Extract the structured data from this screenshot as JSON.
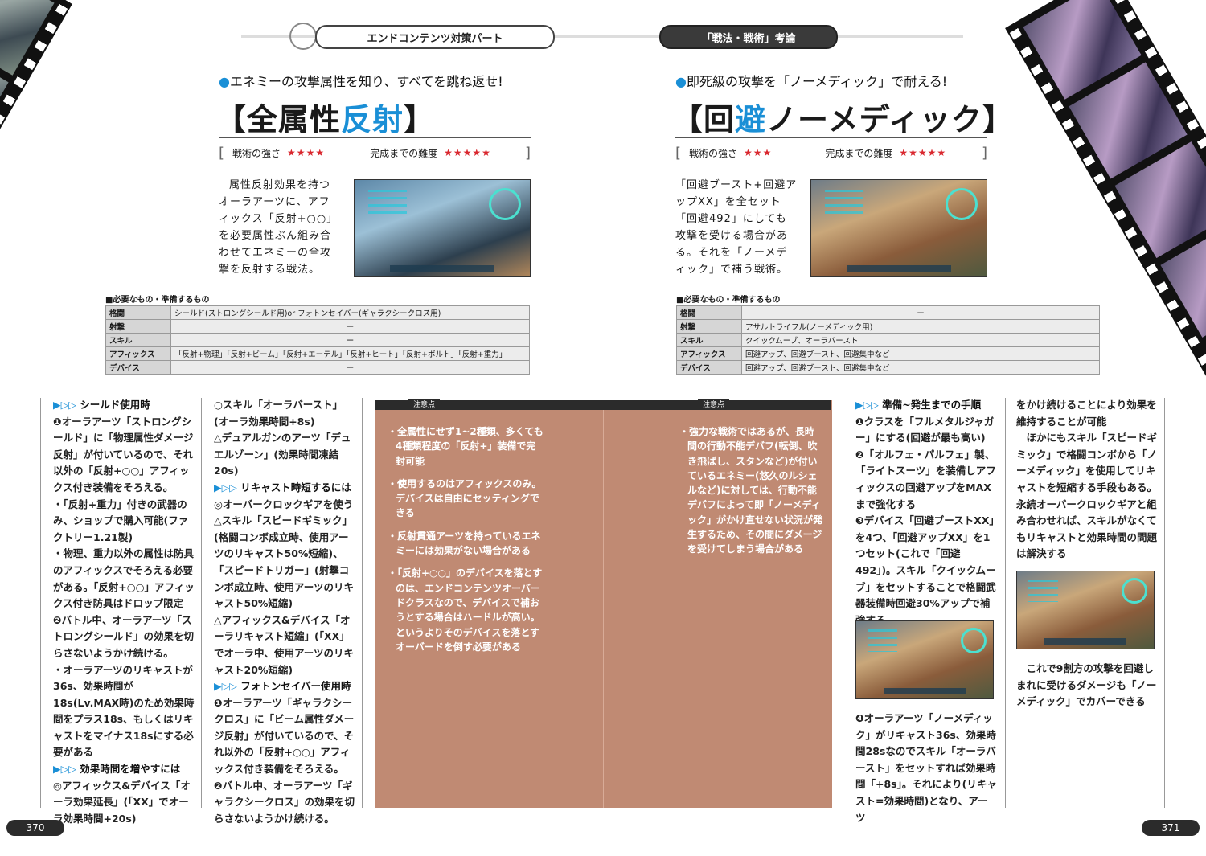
{
  "header": {
    "left_tab": "エンドコンテンツ対策パート",
    "right_tab": "「戦法・戦術」考論"
  },
  "left": {
    "kicker": "エネミーの攻撃属性を知り、すべてを跳ね返せ!",
    "title_pre": "【全属性",
    "title_hl": "反射",
    "title_post": "】",
    "strength_label": "戦術の強さ",
    "strength_stars": "★★★★",
    "difficulty_label": "完成までの難度",
    "difficulty_stars": "★★★★★",
    "intro": "属性反射効果を持つオーラアーツに、アフィックス「反射+○○」を必要属性ぶん組み合わせてエネミーの全攻撃を反射する戦法。",
    "req_label": "■必要なもの・準備するもの",
    "req": [
      {
        "k": "格闘",
        "v": "シールド(ストロングシールド用)or フォトンセイバー(ギャラクシークロス用)",
        "center": false
      },
      {
        "k": "射撃",
        "v": "ー",
        "center": true
      },
      {
        "k": "スキル",
        "v": "ー",
        "center": true
      },
      {
        "k": "アフィックス",
        "v": "「反射+物理」「反射+ビーム」「反射+エーテル」「反射+ヒート」「反射+ボルト」「反射+重力」",
        "center": false
      },
      {
        "k": "デバイス",
        "v": "ー",
        "center": true
      }
    ]
  },
  "right": {
    "kicker": "即死級の攻撃を「ノーメディック」で耐える!",
    "title_pre": "【回",
    "title_hl": "避",
    "title_post": "ノーメディック】",
    "strength_label": "戦術の強さ",
    "strength_stars": "★★★",
    "difficulty_label": "完成までの難度",
    "difficulty_stars": "★★★★★",
    "intro": "「回避ブースト+回避アップXX」を全セット「回避492」にしても攻撃を受ける場合がある。それを「ノーメディック」で補う戦術。",
    "req_label": "■必要なもの・準備するもの",
    "req": [
      {
        "k": "格闘",
        "v": "ー",
        "center": true
      },
      {
        "k": "射撃",
        "v": "アサルトライフル(ノーメディック用)",
        "center": false
      },
      {
        "k": "スキル",
        "v": "クイックムーブ、オーラバースト",
        "center": false
      },
      {
        "k": "アフィックス",
        "v": "回避アップ、回避ブースト、回避集中など",
        "center": false
      },
      {
        "k": "デバイス",
        "v": "回避アップ、回避ブースト、回避集中など",
        "center": false
      }
    ]
  },
  "col1": [
    {
      "t": "h",
      "v": "シールド使用時"
    },
    {
      "t": "p",
      "v": "❶オーラアーツ「ストロングシールド」に「物理属性ダメージ反射」が付いているので、それ以外の「反射+○○」アフィックス付き装備をそろえる。"
    },
    {
      "t": "p",
      "v": "・「反射+重力」付きの武器のみ、ショップで購入可能(ファクトリー1.21製)"
    },
    {
      "t": "p",
      "v": "・物理、重力以外の属性は防具のアフィックスでそろえる必要がある。「反射+○○」アフィックス付き防具はドロップ限定"
    },
    {
      "t": "p",
      "v": "❷バトル中、オーラアーツ「ストロングシールド」の効果を切らさないようかけ続ける。"
    },
    {
      "t": "p",
      "v": "・オーラアーツのリキャストが36s、効果時間が18s(Lv.MAX時)のため効果時間をプラス18s、もしくはリキャストをマイナス18sにする必要がある"
    },
    {
      "t": "h",
      "v": "効果時間を増やすには"
    },
    {
      "t": "p",
      "v": "◎アフィックス&デバイス「オーラ効果延長」(「XX」でオーラ効果時間+20s)"
    }
  ],
  "col2": [
    {
      "t": "p",
      "v": "○スキル「オーラバースト」(オーラ効果時間+8s)"
    },
    {
      "t": "p",
      "v": "△デュアルガンのアーツ「デュエルゾーン」(効果時間凍結20s)"
    },
    {
      "t": "h",
      "v": "リキャスト時短するには"
    },
    {
      "t": "p",
      "v": "◎オーバークロックギアを使う"
    },
    {
      "t": "p",
      "v": "△スキル「スピードギミック」(格闘コンボ成立時、使用アーツのリキャスト50%短縮)、「スピードトリガー」(射撃コンボ成立時、使用アーツのリキャスト50%短縮)"
    },
    {
      "t": "p",
      "v": "△アフィックス&デバイス「オーラリキャスト短縮」(「XX」でオーラ中、使用アーツのリキャスト20%短縮)"
    },
    {
      "t": "h",
      "v": "フォトンセイバー使用時"
    },
    {
      "t": "p",
      "v": "❶オーラアーツ「ギャラクシークロス」に「ビーム属性ダメージ反射」が付いているので、それ以外の「反射+○○」アフィックス付き装備をそろえる。"
    },
    {
      "t": "p",
      "v": "❷バトル中、オーラアーツ「ギャラクシークロス」の効果を切らさないようかけ続ける。"
    }
  ],
  "note_left": {
    "label": "注意点",
    "items": [
      "・全属性にせず1~2種類、多くても4種類程度の「反射+」装備で完封可能",
      "・使用するのはアフィックスのみ。デバイスは自由にセッティングできる",
      "・反射貫通アーツを持っているエネミーには効果がない場合がある",
      "・「反射+○○」のデバイスを落とすのは、エンドコンテンツオーバードクラスなので、デバイスで補おうとする場合はハードルが高い。というよりそのデバイスを落とすオーバードを倒す必要がある"
    ]
  },
  "note_right": {
    "label": "注意点",
    "items": [
      "・強力な戦術ではあるが、長時間の行動不能デバフ(転倒、吹き飛ばし、スタンなど)が付いているエネミー(悠久のルシェルなど)に対しては、行動不能デバフによって即「ノーメディック」がかけ直せない状況が発生するため、その間にダメージを受けてしまう場合がある"
    ]
  },
  "col3a": [
    {
      "t": "h",
      "v": "準備~発生までの手順"
    },
    {
      "t": "p",
      "v": "❶クラスを「フルメタルジャガー」にする(回避が最も高い)"
    },
    {
      "t": "p",
      "v": "❷「オルフェ・パルフェ」製、「ライトスーツ」を装備しアフィックスの回避アップをMAXまで強化する"
    },
    {
      "t": "p",
      "v": "❸デバイス「回避ブーストXX」を4つ、「回避アップXX」を1つセット(これで「回避492」)。スキル「クイックムーブ」をセットすることで格闘武器装備時回避30%アップで補強する"
    }
  ],
  "col3b": [
    {
      "t": "p",
      "v": "❹オーラアーツ「ノーメディック」がリキャスト36s、効果時間28sなのでスキル「オーラバースト」をセットすれば効果時間「+8s」。それにより(リキャスト=効果時間)となり、アーツ"
    }
  ],
  "col4a": [
    {
      "t": "p",
      "v": "をかけ続けることにより効果を維持することが可能"
    },
    {
      "t": "p",
      "v": "ほかにもスキル「スピードギミック」で格闘コンボから「ノーメディック」を使用してリキャストを短縮する手段もある。永続オーバークロックギアと組み合わせれば、スキルがなくてもリキャストと効果時間の問題は解決する"
    }
  ],
  "col4b": [
    {
      "t": "p",
      "v": "これで9割方の攻撃を回避しまれに受けるダメージも「ノーメディック」でカバーできる"
    }
  ],
  "pages": {
    "left": "370",
    "right": "371"
  }
}
